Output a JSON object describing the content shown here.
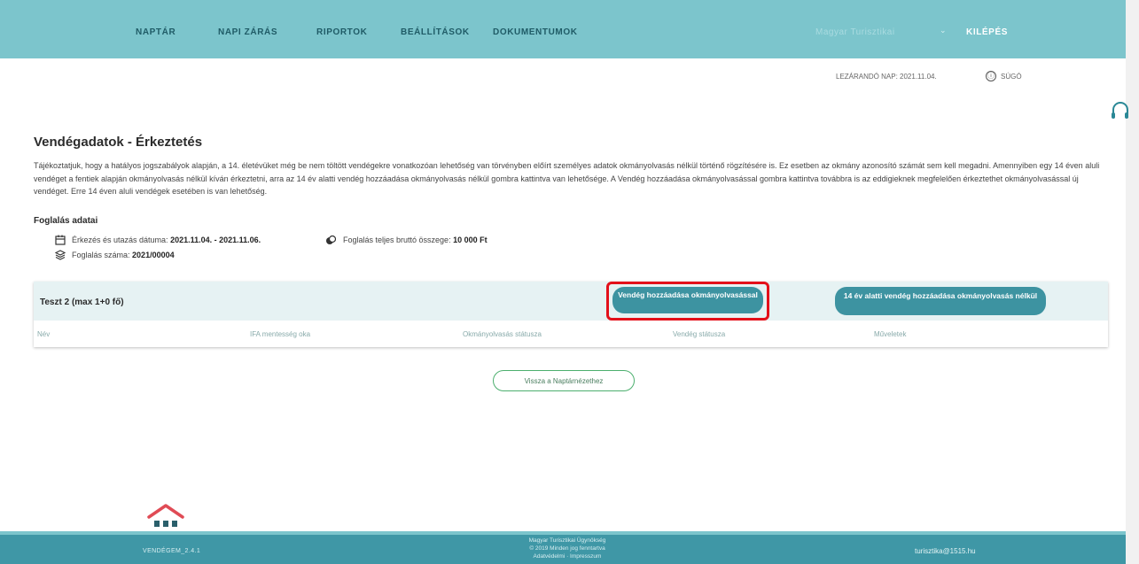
{
  "nav": {
    "items": [
      {
        "label": "NAPTÁR"
      },
      {
        "label": "NAPI ZÁRÁS"
      },
      {
        "label": "RIPORTOK"
      },
      {
        "label": "BEÁLLÍTÁSOK"
      },
      {
        "label": "DOKUMENTUMOK"
      }
    ],
    "user_label": "Magyar Turisztikai",
    "logout": "KILÉPÉS"
  },
  "subheader": {
    "closing_day": "LEZÁRANDÓ NAP: 2021.11.04.",
    "help": "SÚGÓ",
    "help_icon": "ⓘ"
  },
  "page": {
    "title": "Vendégadatok - Érkeztetés",
    "intro": "Tájékoztatjuk, hogy a hatályos jogszabályok alapján, a 14. életévüket még be nem töltött vendégekre vonatkozóan lehetőség van törvényben előírt személyes adatok okmányolvasás nélkül történő rögzítésére is. Ez esetben az okmány azonosító számát sem kell megadni. Amennyiben egy 14 éven aluli vendéget a fentiek alapján okmányolvasás nélkül kíván érkeztetni, arra az 14 év alatti vendég hozzáadása okmányolvasás nélkül gombra kattintva van lehetősége. A Vendég hozzáadása okmányolvasással gombra kattintva továbbra is az eddigieknek megfelelően érkeztethet okmányolvasással új vendéget. Erre 14 éven aluli vendégek esetében is van lehetőség."
  },
  "booking": {
    "section_title": "Foglalás adatai",
    "dates_label": "Érkezés és utazás dátuma:",
    "dates_value": "2021.11.04. - 2021.11.06.",
    "total_label": "Foglalás teljes bruttó összege:",
    "total_value": "10 000 Ft",
    "number_label": "Foglalás száma:",
    "number_value": "2021/00004"
  },
  "room": {
    "title": "Teszt 2 (max 1+0 fő)",
    "add_with_doc": "Vendég hozzáadása okmányolvasással",
    "add_without_doc": "14 év alatti vendég hozzáadása okmányolvasás nélkül",
    "columns": [
      "Név",
      "IFA mentesség oka",
      "Okmányolvasás státusza",
      "Vendég státusza",
      "Műveletek"
    ]
  },
  "back_button": "Vissza a Naptárnézethez",
  "footer": {
    "version": "VENDÉGEM_2.4.1",
    "line1": "Magyar Turisztikai Ügynökség",
    "line2": "© 2019 Minden jog fenntartva",
    "line3": "Adatvédelmi · Impresszum",
    "email": "turisztika@1515.hu"
  },
  "colors": {
    "header": "#7cc5cc",
    "primary_button": "#3d93a1",
    "highlight": "#e3101a",
    "footer": "#3f97a6"
  }
}
